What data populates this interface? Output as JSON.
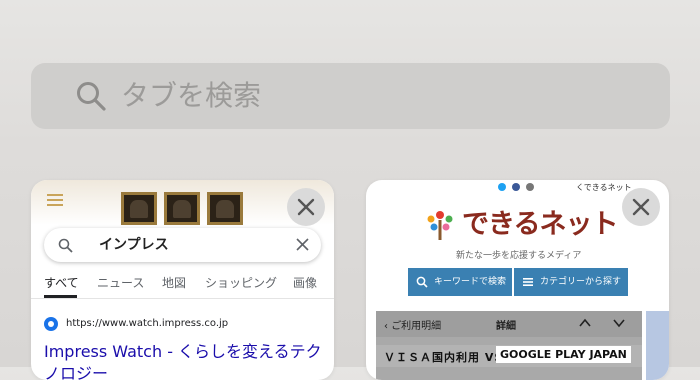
{
  "search": {
    "placeholder": "タブを検索"
  },
  "tabs": [
    {
      "search_query": "インプレス",
      "filter_tabs": [
        "すべて",
        "ニュース",
        "地図",
        "ショッピング",
        "画像"
      ],
      "result_url": "https://www.watch.impress.co.jp",
      "result_title": "Impress Watch - くらしを変えるテク",
      "result_title_line2": "ノロジー"
    },
    {
      "logo_text": "できるネット",
      "tagline": "新たな一歩を応援するメディア",
      "buttons": [
        "キーワードで検索",
        "カテゴリーから探す"
      ],
      "top_text": "くできるネット",
      "screenshot": {
        "back_label": "ご利用明細",
        "detail_label": "詳細",
        "row_left": "ＶＩＳＡ国内利用 VS",
        "row_right": "GOOGLE PLAY JAPAN"
      }
    }
  ],
  "colors": {
    "link": "#1a0dab",
    "brand": "#8a2a1e",
    "button": "#3a80b2"
  }
}
